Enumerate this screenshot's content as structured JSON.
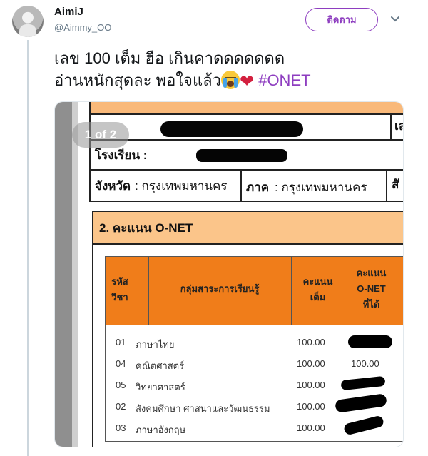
{
  "user": {
    "name": "AimiJ",
    "handle": "@Aimmy_OO",
    "follow_label": "ติดตาม"
  },
  "tweet": {
    "line1": "เลข 100 เต็ม ฮือ เกินคาดดดดดดด",
    "line2": "อ่านหนักสุดละ พอใจแล้ว",
    "hashtag": "#ONET"
  },
  "media": {
    "pager": "1 of 2",
    "doc": {
      "school_label": "โรงเรียน :",
      "province_label": "จังหวัด",
      "province_value": ": กรุงเทพมหานคร",
      "region_label": "ภาค",
      "region_value": ": กรุงเทพมหานคร",
      "cut_label_1": "เล",
      "cut_label_2": "สั",
      "section_title": "2. คะแนน  O-NET",
      "headers": {
        "code_1": "รหัส",
        "code_2": "วิชา",
        "subject": "กลุ่มสาระการเรียนรู้",
        "full_1": "คะแนน",
        "full_2": "เต็ม",
        "got_1": "คะแนน",
        "got_2": "O-NET",
        "got_3": "ที่ได้"
      },
      "rows": [
        {
          "code": "01",
          "subject": "ภาษาไทย",
          "full": "100.00",
          "got": ""
        },
        {
          "code": "04",
          "subject": "คณิตศาสตร์",
          "full": "100.00",
          "got": "100.00"
        },
        {
          "code": "05",
          "subject": "วิทยาศาสตร์",
          "full": "100.00",
          "got": ""
        },
        {
          "code": "02",
          "subject": "สังคมศึกษา ศาสนาและวัฒนธรรม",
          "full": "100.00",
          "got": ""
        },
        {
          "code": "03",
          "subject": "ภาษาอังกฤษ",
          "full": "100.00",
          "got": ""
        }
      ]
    }
  },
  "colors": {
    "accent": "#8e3ec0",
    "header_orange": "#f07d1a",
    "section_orange": "#fbc58a"
  }
}
